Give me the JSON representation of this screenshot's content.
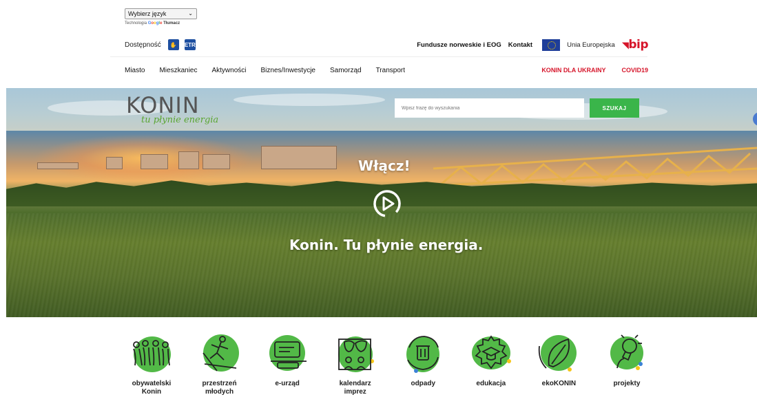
{
  "top": {
    "language_select": "Wybierz język",
    "translator_prefix": "Technologia",
    "translator_brand": "Google",
    "translator_name": "Tłumacz"
  },
  "utility": {
    "accessibility": "Dostępność",
    "links": [
      "Fundusze norweskie i EOG",
      "Kontakt"
    ],
    "eu": "Unia Europejska",
    "bip": "bip"
  },
  "nav": {
    "items": [
      "Miasto",
      "Mieszkaniec",
      "Aktywności",
      "Biznes/Inwestycje",
      "Samorząd",
      "Transport"
    ],
    "highlight": [
      "KONIN DLA UKRAINY",
      "COVID19"
    ]
  },
  "header": {
    "logo_text": "KONIN",
    "logo_tagline": "tu płynie energia",
    "search_placeholder": "Wpisz frazę do wyszukania",
    "search_button": "SZUKAJ"
  },
  "hero": {
    "cta": "Włącz!",
    "title": "Konin. Tu płynie energia."
  },
  "quick_links": [
    {
      "label": "obywatelski Konin",
      "icon": "people-icon"
    },
    {
      "label": "przestrzeń młodych",
      "icon": "skater-icon"
    },
    {
      "label": "e-urząd",
      "icon": "keyboard-icon"
    },
    {
      "label": "kalendarz imprez",
      "icon": "theater-masks-icon"
    },
    {
      "label": "odpady",
      "icon": "recycle-bin-icon"
    },
    {
      "label": "edukacja",
      "icon": "graduation-cap-icon"
    },
    {
      "label": "ekoKONIN",
      "icon": "leaf-icon"
    },
    {
      "label": "projekty",
      "icon": "lightbulb-icon"
    }
  ],
  "colors": {
    "green": "#3ab54a",
    "icon_green": "#52b947",
    "red": "#d6152a",
    "accessibility_blue": "#1e4fa0"
  }
}
